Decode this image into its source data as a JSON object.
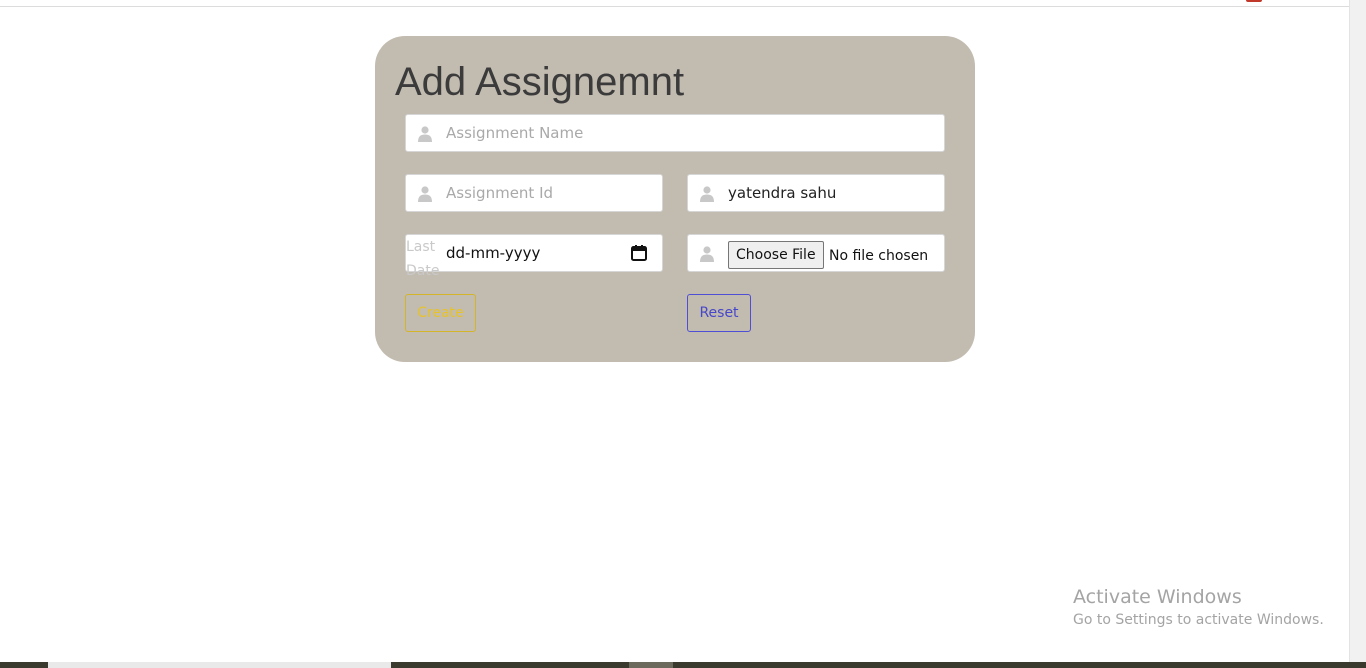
{
  "form": {
    "title": "Add Assignemnt",
    "assignment_name_placeholder": "Assignment Name",
    "assignment_id_placeholder": "Assignment Id",
    "teacher_value": "yatendra sahu",
    "last_date_label": "Last Date",
    "date_value": "dd-mm-yyyy",
    "choose_file_label": "Choose File",
    "no_file_text": "No file chosen",
    "create_label": "Create",
    "reset_label": "Reset"
  },
  "watermark": {
    "title": "Activate Windows",
    "subtitle": "Go to Settings to activate Windows."
  },
  "colors": {
    "card_background": "#c2bbb0",
    "create_button": "#e6c32b",
    "reset_button": "#4747c9"
  },
  "icons": [
    "user-icon",
    "calendar-icon"
  ]
}
